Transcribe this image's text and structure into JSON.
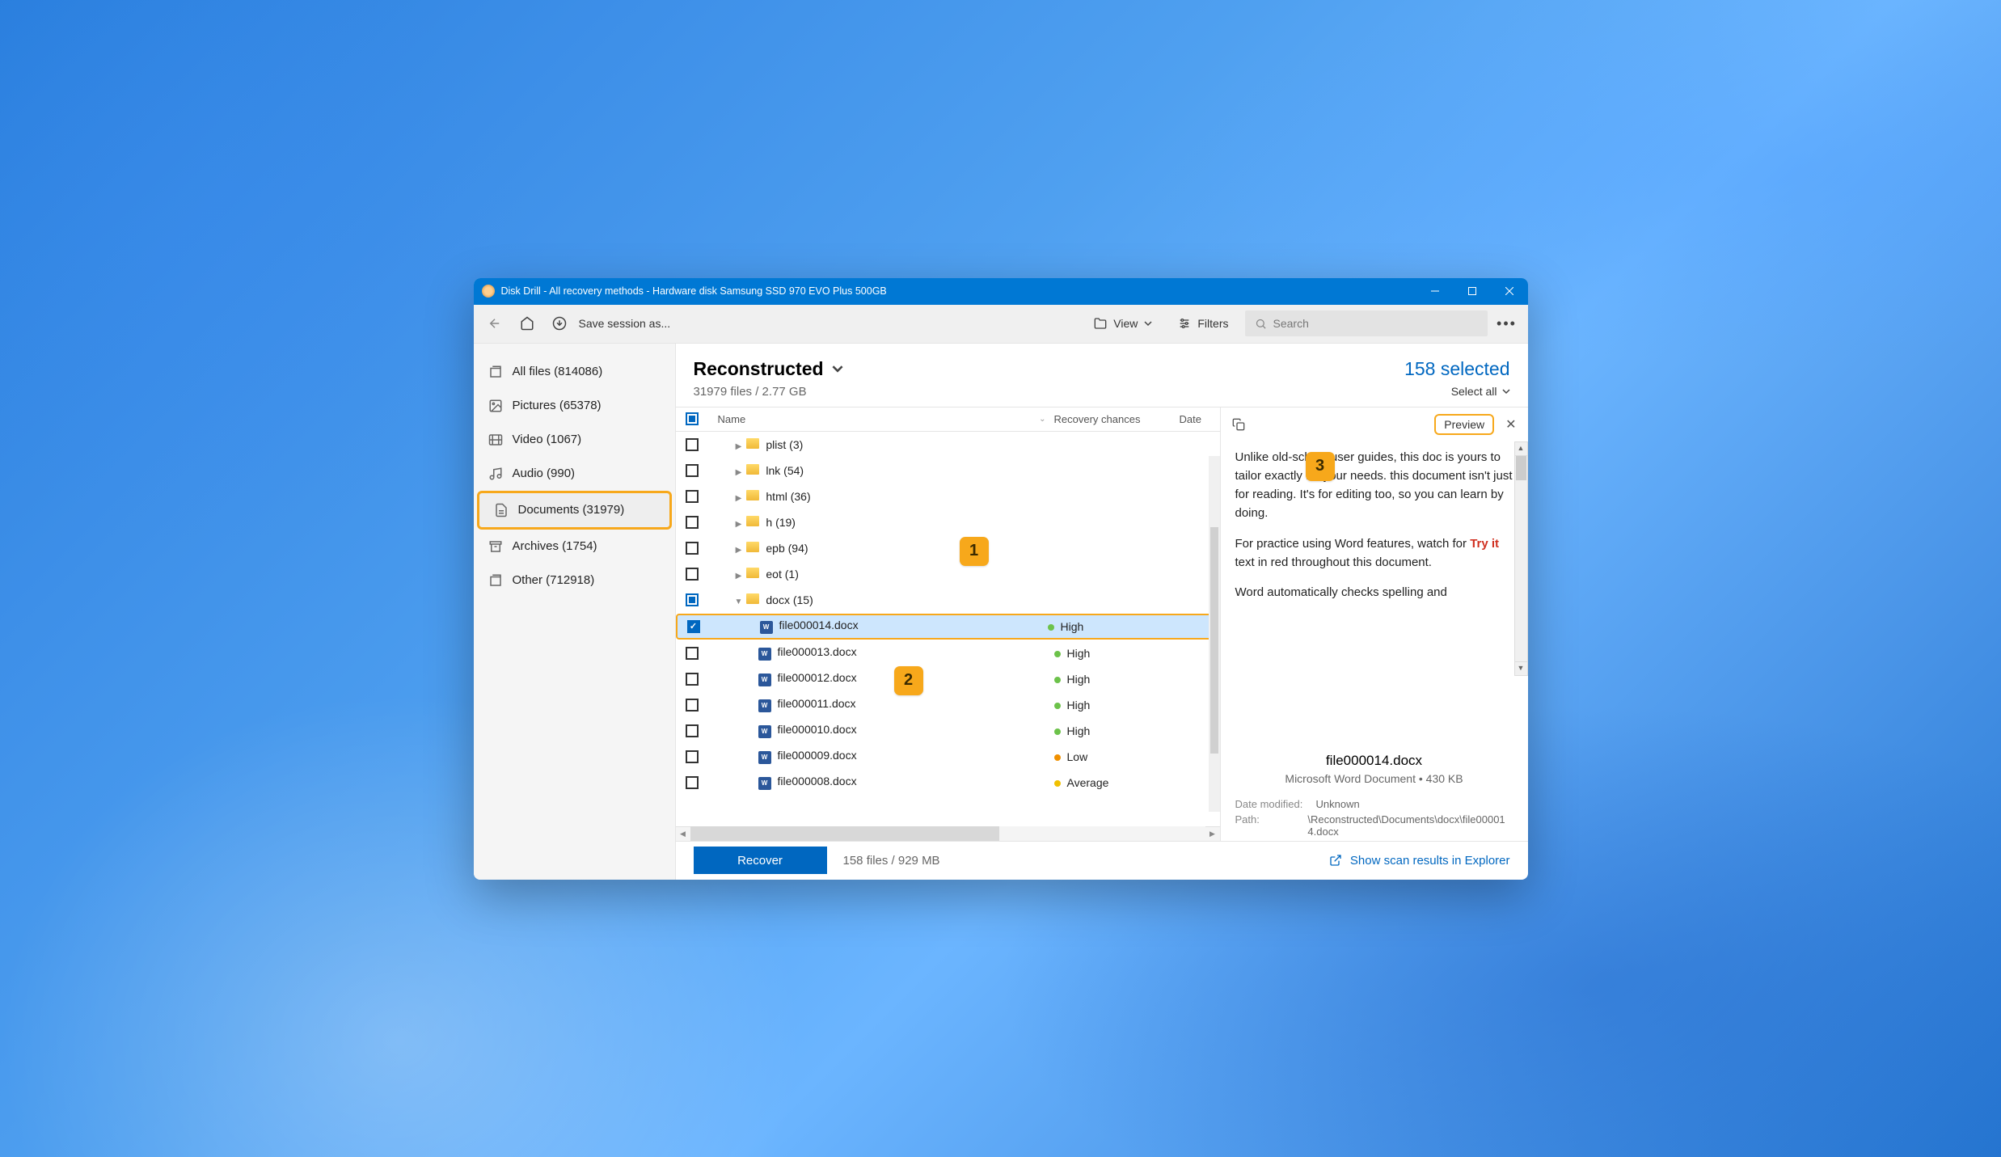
{
  "titlebar": {
    "text": "Disk Drill - All recovery methods - Hardware disk Samsung SSD 970 EVO Plus 500GB"
  },
  "toolbar": {
    "save_session": "Save session as...",
    "view": "View",
    "filters": "Filters",
    "search_placeholder": "Search"
  },
  "sidebar": {
    "items": [
      {
        "label": "All files (814086)"
      },
      {
        "label": "Pictures (65378)"
      },
      {
        "label": "Video (1067)"
      },
      {
        "label": "Audio (990)"
      },
      {
        "label": "Documents (31979)"
      },
      {
        "label": "Archives (1754)"
      },
      {
        "label": "Other (712918)"
      }
    ]
  },
  "main": {
    "title": "Reconstructed",
    "subtitle": "31979 files / 2.77 GB",
    "selected": "158 selected",
    "select_all": "Select all"
  },
  "columns": {
    "name": "Name",
    "recovery": "Recovery chances",
    "date": "Date"
  },
  "folders": [
    {
      "name": "plist (3)"
    },
    {
      "name": "lnk (54)"
    },
    {
      "name": "html (36)"
    },
    {
      "name": "h (19)"
    },
    {
      "name": "epb (94)"
    },
    {
      "name": "eot (1)"
    },
    {
      "name": "docx (15)"
    }
  ],
  "files": [
    {
      "name": "file000014.docx",
      "recovery": "High",
      "level": "high",
      "selected": true
    },
    {
      "name": "file000013.docx",
      "recovery": "High",
      "level": "high"
    },
    {
      "name": "file000012.docx",
      "recovery": "High",
      "level": "high"
    },
    {
      "name": "file000011.docx",
      "recovery": "High",
      "level": "high"
    },
    {
      "name": "file000010.docx",
      "recovery": "High",
      "level": "high"
    },
    {
      "name": "file000009.docx",
      "recovery": "Low",
      "level": "low"
    },
    {
      "name": "file000008.docx",
      "recovery": "Average",
      "level": "avg"
    }
  ],
  "preview": {
    "button": "Preview",
    "para1": "Unlike old-school user guides, this doc is yours to tailor exactly for your needs. this document isn't just for reading. It's for editing too, so you can learn by doing.",
    "para2a": "For practice using Word features, watch for ",
    "para2b": "Try it",
    "para2c": " text in red throughout this document.",
    "para3": "Word automatically checks spelling and",
    "filename": "file000014.docx",
    "filetype": "Microsoft Word Document • 430 KB",
    "date_modified_label": "Date modified:",
    "date_modified_value": "Unknown",
    "path_label": "Path:",
    "path_value": "\\Reconstructed\\Documents\\docx\\file000014.docx"
  },
  "footer": {
    "recover": "Recover",
    "summary": "158 files / 929 MB",
    "explorer_link": "Show scan results in Explorer"
  },
  "callouts": {
    "c1": "1",
    "c2": "2",
    "c3": "3"
  }
}
